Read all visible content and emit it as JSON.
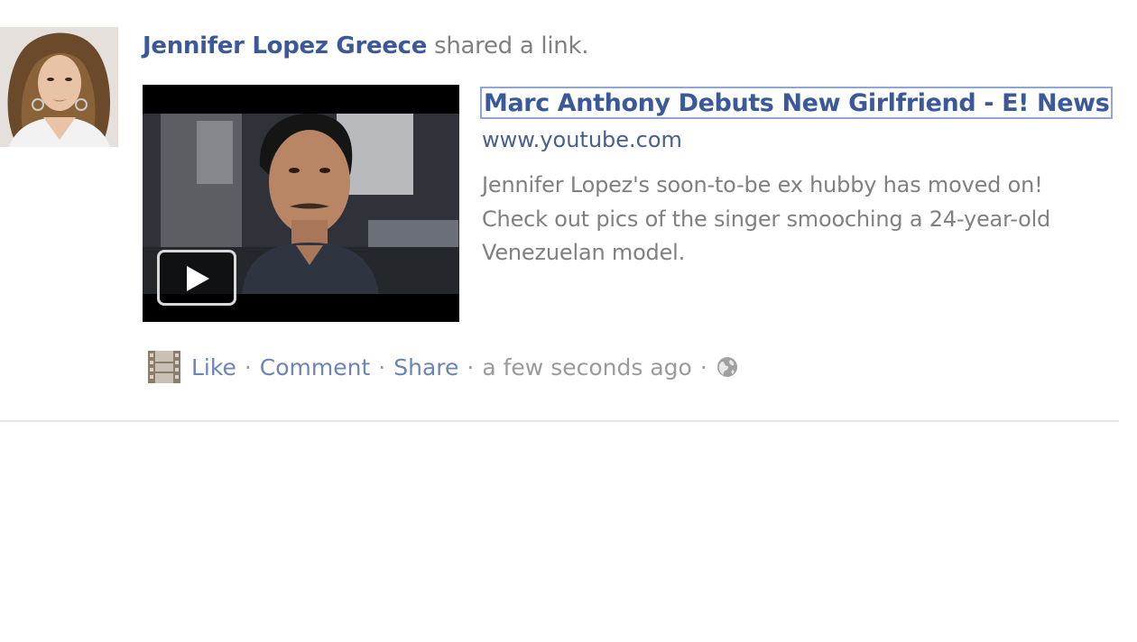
{
  "story": {
    "actor_name": "Jennifer Lopez Greece",
    "action_text": "shared a link."
  },
  "attachment": {
    "title": "Marc Anthony Debuts New Girlfriend - E! News",
    "domain": "www.youtube.com",
    "description": "Jennifer Lopez's soon-to-be ex hubby has moved on! Check out pics of the singer smooching a 24-year-old Venezuelan model.",
    "thumbnail_icon": "play-icon"
  },
  "footer": {
    "attachment_type_icon": "film-strip-icon",
    "like_label": "Like",
    "comment_label": "Comment",
    "share_label": "Share",
    "separator": "·",
    "timestamp": "a few seconds ago",
    "privacy_icon": "globe-icon"
  },
  "colors": {
    "link_blue": "#3b5998",
    "muted_link": "#6d84b4",
    "gray_text": "#808080"
  }
}
